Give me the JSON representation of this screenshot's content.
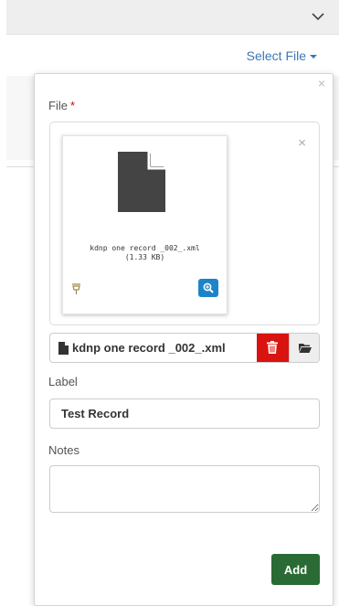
{
  "header": {
    "expand_icon": "chevron-down-icon"
  },
  "select_file": {
    "label": "Select File"
  },
  "popover": {
    "close_symbol": "×",
    "file_label": "File",
    "required_mark": "*",
    "preview": {
      "close_symbol": "×",
      "file_name": "kdnp one record _002_.xml",
      "file_size": "(1.33 KB)",
      "file_icon": "file-icon",
      "drag_icon": "drag-handle-icon",
      "zoom_icon": "zoom-in-icon"
    },
    "file_input": {
      "value": "kdnp one record _002_.xml",
      "remove_icon": "trash-icon",
      "browse_icon": "folder-open-icon"
    },
    "label_field": {
      "label": "Label",
      "value": "Test Record"
    },
    "notes_field": {
      "label": "Notes",
      "value": ""
    },
    "add_label": "Add"
  },
  "colors": {
    "link": "#3b77b6",
    "danger": "#d9130f",
    "primary": "#2a6a34",
    "info": "#1e84c8"
  }
}
